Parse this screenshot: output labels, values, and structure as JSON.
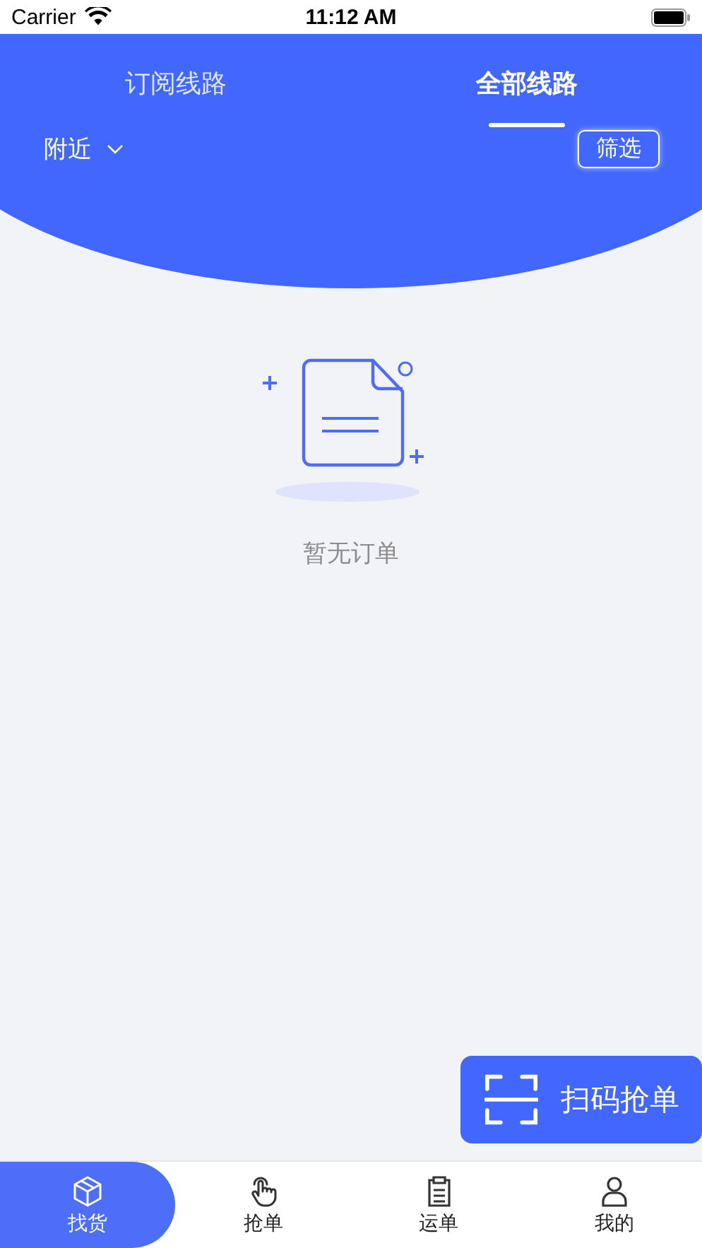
{
  "status_bar": {
    "carrier": "Carrier",
    "time": "11:12 AM"
  },
  "tabs": [
    {
      "label": "订阅线路",
      "selected": false
    },
    {
      "label": "全部线路",
      "selected": true
    }
  ],
  "location_filter": {
    "label": "附近"
  },
  "filter_button": "筛选",
  "empty_state": {
    "message": "暂无订单"
  },
  "scan_button": "扫码抢单",
  "bottom_nav": [
    {
      "label": "找货",
      "kind": "box",
      "selected": true
    },
    {
      "label": "抢单",
      "kind": "hand",
      "selected": false
    },
    {
      "label": "运单",
      "kind": "clipboard",
      "selected": false
    },
    {
      "label": "我的",
      "kind": "person",
      "selected": false
    }
  ]
}
